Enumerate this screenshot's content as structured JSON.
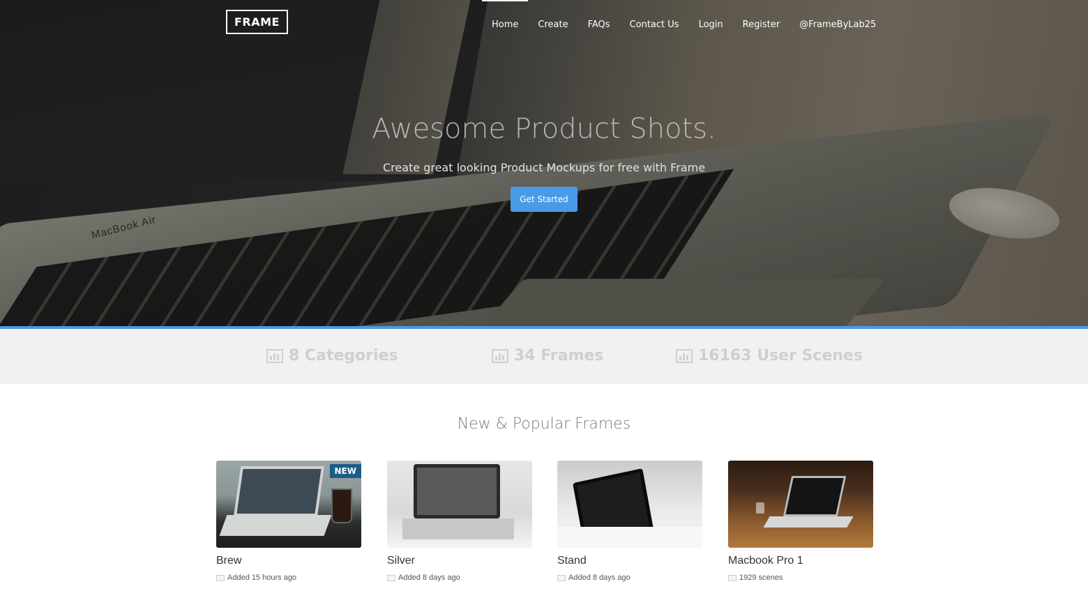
{
  "brand": {
    "logo": "FRAME"
  },
  "nav": {
    "items": [
      {
        "label": "Home",
        "active": true
      },
      {
        "label": "Create",
        "active": false
      },
      {
        "label": "FAQs",
        "active": false
      },
      {
        "label": "Contact Us",
        "active": false
      },
      {
        "label": "Login",
        "active": false
      },
      {
        "label": "Register",
        "active": false
      },
      {
        "label": "@FrameByLab25",
        "active": false
      }
    ]
  },
  "hero": {
    "title": "Awesome Product Shots.",
    "subtitle": "Create great looking Product Mockups for free with Frame",
    "cta_label": "Get Started",
    "photo_text": "MacBook Air"
  },
  "stats": [
    {
      "label": "8 Categories",
      "icon": "bar-chart-icon"
    },
    {
      "label": "34 Frames",
      "icon": "bar-chart-icon"
    },
    {
      "label": "16163 User Scenes",
      "icon": "bar-chart-icon"
    }
  ],
  "section": {
    "title": "New & Popular Frames"
  },
  "frames": [
    {
      "title": "Brew",
      "meta": "Added 15 hours ago",
      "badge": "NEW",
      "icon": "image-icon"
    },
    {
      "title": "Silver",
      "meta": "Added 8 days ago",
      "badge": "",
      "icon": "image-icon"
    },
    {
      "title": "Stand",
      "meta": "Added 8 days ago",
      "badge": "",
      "icon": "image-icon"
    },
    {
      "title": "Macbook Pro 1",
      "meta": "1929 scenes",
      "badge": "",
      "icon": "image-icon"
    }
  ],
  "colors": {
    "accent": "#4a9be6",
    "badge": "#1b5d86",
    "stats_bg": "#f1f1f1"
  }
}
